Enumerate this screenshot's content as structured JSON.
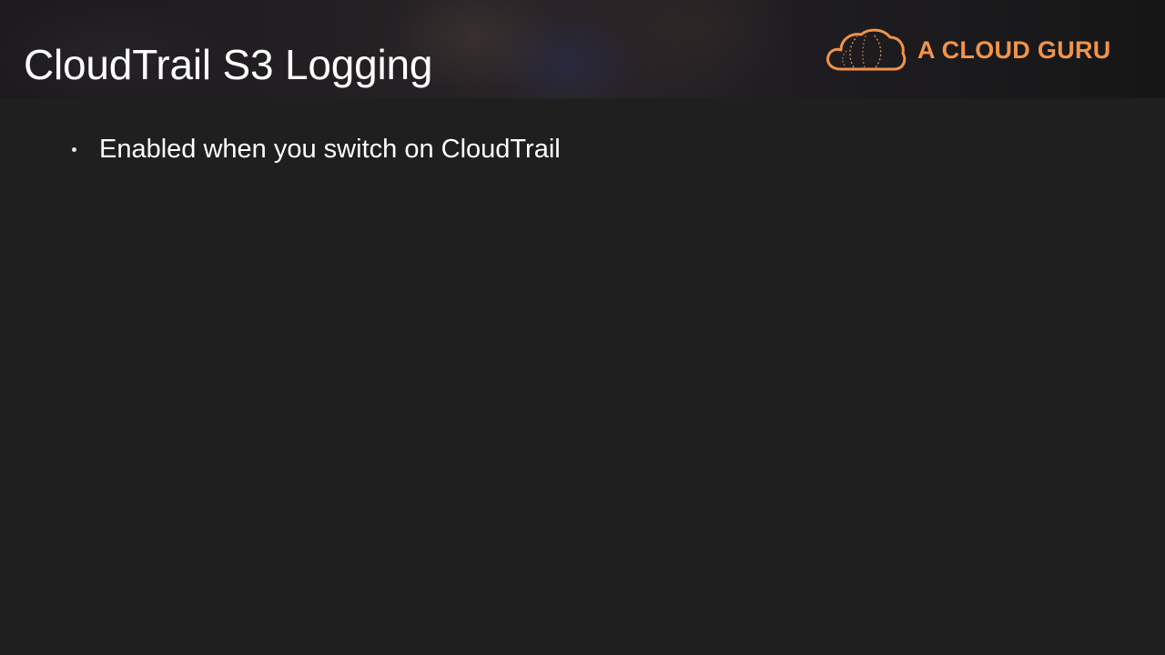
{
  "slide": {
    "title": "CloudTrail S3 Logging",
    "bullets": [
      {
        "text": "Enabled when you switch on CloudTrail"
      }
    ]
  },
  "brand": {
    "name": "A CLOUD GURU",
    "logo_icon": "cloud-logo-icon",
    "accent_color": "#f0934a"
  },
  "theme": {
    "background": "#1f1f1f",
    "text_color": "#ffffff"
  }
}
